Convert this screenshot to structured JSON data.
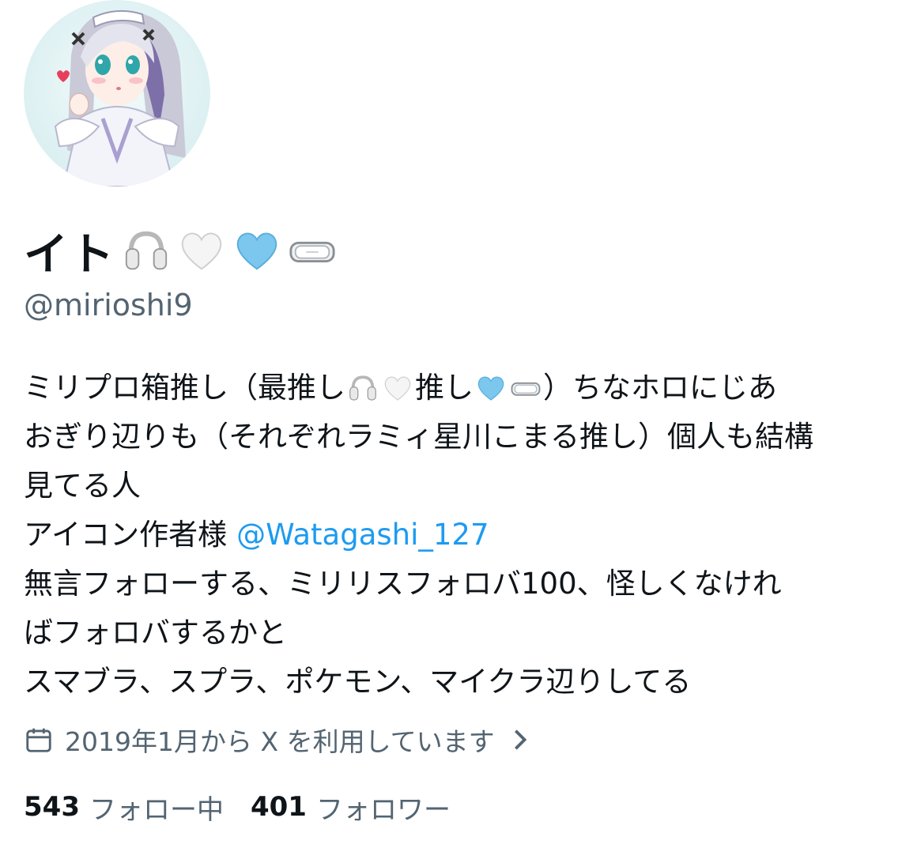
{
  "profile": {
    "display_name": "イト",
    "name_emojis": [
      "headphones-icon",
      "white-heart-icon",
      "light-blue-heart-icon",
      "goggles-icon"
    ],
    "handle": "@mirioshi9"
  },
  "bio": {
    "line1_a": "ミリプロ箱推し（最推し",
    "line1_b": "推し",
    "line1_c": "）ちなホロにじあ",
    "line2": "おぎり辺りも（それぞれラミィ星川こまる推し）個人も結構",
    "line3": "見てる人",
    "line4_prefix": "アイコン作者様 ",
    "line4_mention": "@Watagashi_127",
    "line5": "無言フォローする、ミリリスフォロバ100、怪しくなけれ",
    "line6": "ばフォロバするかと",
    "line7": "スマブラ、スプラ、ポケモン、マイクラ辺りしてる"
  },
  "joined": {
    "text": "2019年1月から X を利用しています",
    "icon": "calendar-icon"
  },
  "stats": {
    "following_count": "543",
    "following_label": "フォロー中",
    "followers_count": "401",
    "followers_label": "フォロワー"
  },
  "colors": {
    "text": "#0f1419",
    "secondary": "#536471",
    "link": "#1d9bf0"
  }
}
